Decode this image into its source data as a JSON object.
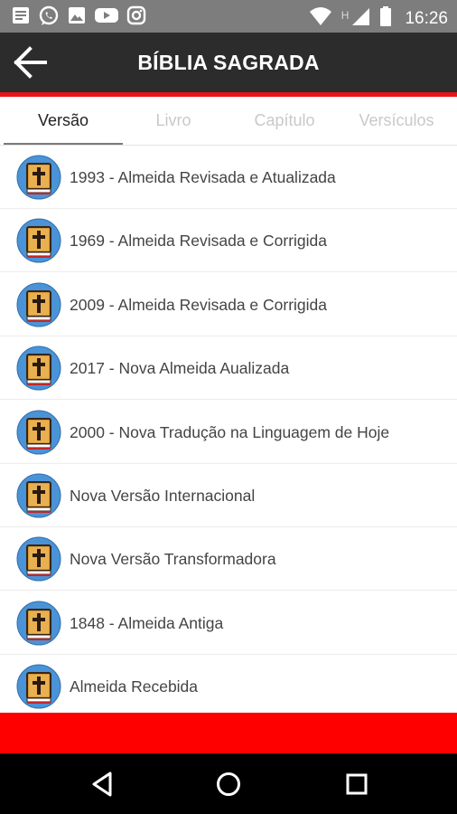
{
  "status_bar": {
    "time": "16:26",
    "network_letter": "H",
    "left_icons": [
      "news-icon",
      "whatsapp-icon",
      "gallery-icon",
      "youtube-icon",
      "instagram-icon"
    ],
    "right_icons": [
      "wifi-icon",
      "signal-icon",
      "battery-icon"
    ]
  },
  "app_bar": {
    "title": "BÍBLIA SAGRADA",
    "back_icon": "arrow-left-icon",
    "background": "#2c2c2c",
    "accent": "#e8141c"
  },
  "tabs": [
    {
      "label": "Versão",
      "active": true
    },
    {
      "label": "Livro",
      "active": false
    },
    {
      "label": "Capítulo",
      "active": false
    },
    {
      "label": "Versículos",
      "active": false
    }
  ],
  "versions": [
    {
      "label": "1993 - Almeida Revisada e Atualizada",
      "icon": "bible-icon"
    },
    {
      "label": "1969 - Almeida Revisada e Corrigida",
      "icon": "bible-icon"
    },
    {
      "label": "2009 - Almeida Revisada e Corrigida",
      "icon": "bible-icon"
    },
    {
      "label": "2017 - Nova Almeida Aualizada",
      "icon": "bible-icon"
    },
    {
      "label": "2000 - Nova Tradução na Linguagem de Hoje",
      "icon": "bible-icon"
    },
    {
      "label": "Nova Versão Internacional",
      "icon": "bible-icon"
    },
    {
      "label": "Nova Versão Transformadora",
      "icon": "bible-icon"
    },
    {
      "label": "1848 - Almeida Antiga",
      "icon": "bible-icon"
    },
    {
      "label": "Almeida Recebida",
      "icon": "bible-icon"
    }
  ],
  "banner": {
    "color": "#ff0000"
  },
  "nav_bar": {
    "icons": [
      "back-triangle-icon",
      "home-circle-icon",
      "recents-square-icon"
    ]
  }
}
